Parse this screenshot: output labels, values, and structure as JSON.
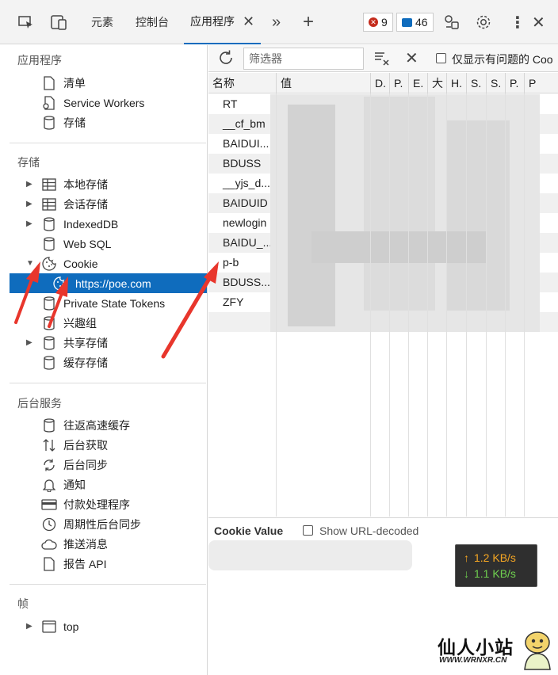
{
  "tabbar": {
    "tabs": [
      "元素",
      "控制台",
      "应用程序"
    ],
    "errors_count": "9",
    "messages_count": "46"
  },
  "sidebar": {
    "sections": {
      "application": "应用程序",
      "storage": "存储",
      "background": "后台服务",
      "frames": "帧"
    },
    "application_items": [
      "清单",
      "Service Workers",
      "存储"
    ],
    "storage_items": [
      "本地存储",
      "会话存储",
      "IndexedDB",
      "Web SQL",
      "Cookie",
      "https://poe.com",
      "Private State Tokens",
      "兴趣组",
      "共享存储",
      "缓存存储"
    ],
    "background_items": [
      "往返高速缓存",
      "后台获取",
      "后台同步",
      "通知",
      "付款处理程序",
      "周期性后台同步",
      "推送消息",
      "报告 API"
    ],
    "frame_items": [
      "top"
    ]
  },
  "toolbar": {
    "filter_placeholder": "筛选器",
    "only_issues_label": "仅显示有问题的 Coo"
  },
  "table": {
    "columns": [
      "名称",
      "值",
      "D.",
      "P.",
      "E.",
      "大",
      "H.",
      "S.",
      "S.",
      "P.",
      "P"
    ],
    "rows": [
      "RT",
      "__cf_bm",
      "BAIDUI...",
      "BDUSS",
      "__yjs_d...",
      "BAIDUID",
      "newlogin",
      "BAIDU_...",
      "p-b",
      "BDUSS...",
      "ZFY"
    ]
  },
  "value_panel": {
    "title": "Cookie Value",
    "decode_label": "Show URL-decoded"
  },
  "netspeed": {
    "up": "1.2 KB/s",
    "down": "1.1 KB/s",
    "up_color": "#f5a623",
    "down_color": "#6fd14f"
  },
  "watermark": {
    "title": "仙人小站",
    "url": "WWW.WRNXR.CN"
  },
  "colors": {
    "accent": "#0f6cbd",
    "annotation_arrow": "#e8362c"
  }
}
